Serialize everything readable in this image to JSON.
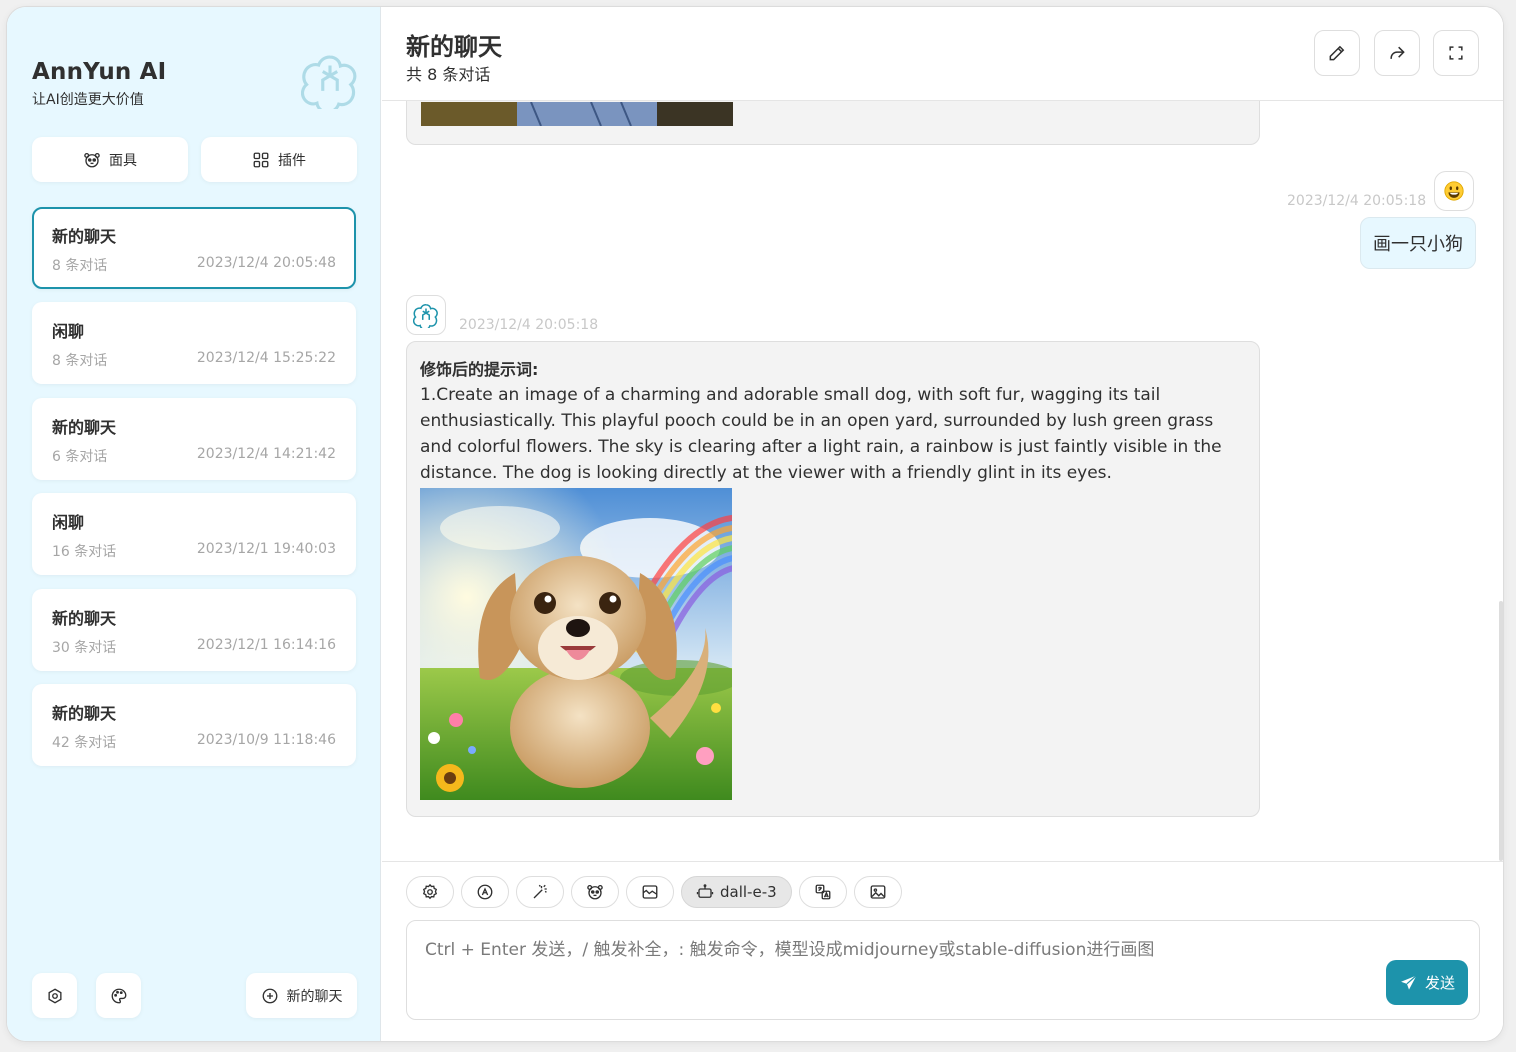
{
  "brand": {
    "title": "AnnYun AI",
    "subtitle": "让AI创造更大价值"
  },
  "sidebar": {
    "masks_label": "面具",
    "plugins_label": "插件",
    "chats": [
      {
        "title": "新的聊天",
        "count": "8 条对话",
        "time": "2023/12/4 20:05:48",
        "active": true
      },
      {
        "title": "闲聊",
        "count": "8 条对话",
        "time": "2023/12/4 15:25:22"
      },
      {
        "title": "新的聊天",
        "count": "6 条对话",
        "time": "2023/12/4 14:21:42"
      },
      {
        "title": "闲聊",
        "count": "16 条对话",
        "time": "2023/12/1 19:40:03"
      },
      {
        "title": "新的聊天",
        "count": "30 条对话",
        "time": "2023/12/1 16:14:16"
      },
      {
        "title": "新的聊天",
        "count": "42 条对话",
        "time": "2023/10/9 11:18:46"
      }
    ],
    "new_chat_label": "新的聊天"
  },
  "header": {
    "title": "新的聊天",
    "subtitle": "共 8 条对话"
  },
  "messages": {
    "user": {
      "time": "2023/12/4 20:05:18",
      "text": "画一只小狗"
    },
    "bot": {
      "time": "2023/12/4 20:05:18",
      "heading": "修饰后的提示词:",
      "text": "1.Create an image of a charming and adorable small dog, with soft fur, wagging its tail enthusiastically. This playful pooch could be in an open yard, surrounded by lush green grass and colorful flowers. The sky is clearing after a light rain, a rainbow is just faintly visible in the distance. The dog is looking directly at the viewer with a friendly glint in its eyes."
    }
  },
  "composer": {
    "model_label": "dall-e-3",
    "placeholder": "Ctrl + Enter 发送，/ 触发补全，: 触发命令，模型设成midjourney或stable-diffusion进行画图",
    "send_label": "发送"
  },
  "colors": {
    "accent": "#1d93ab",
    "sidebar_bg": "#e7f8ff",
    "bubble_bg": "#f3f3f3"
  }
}
